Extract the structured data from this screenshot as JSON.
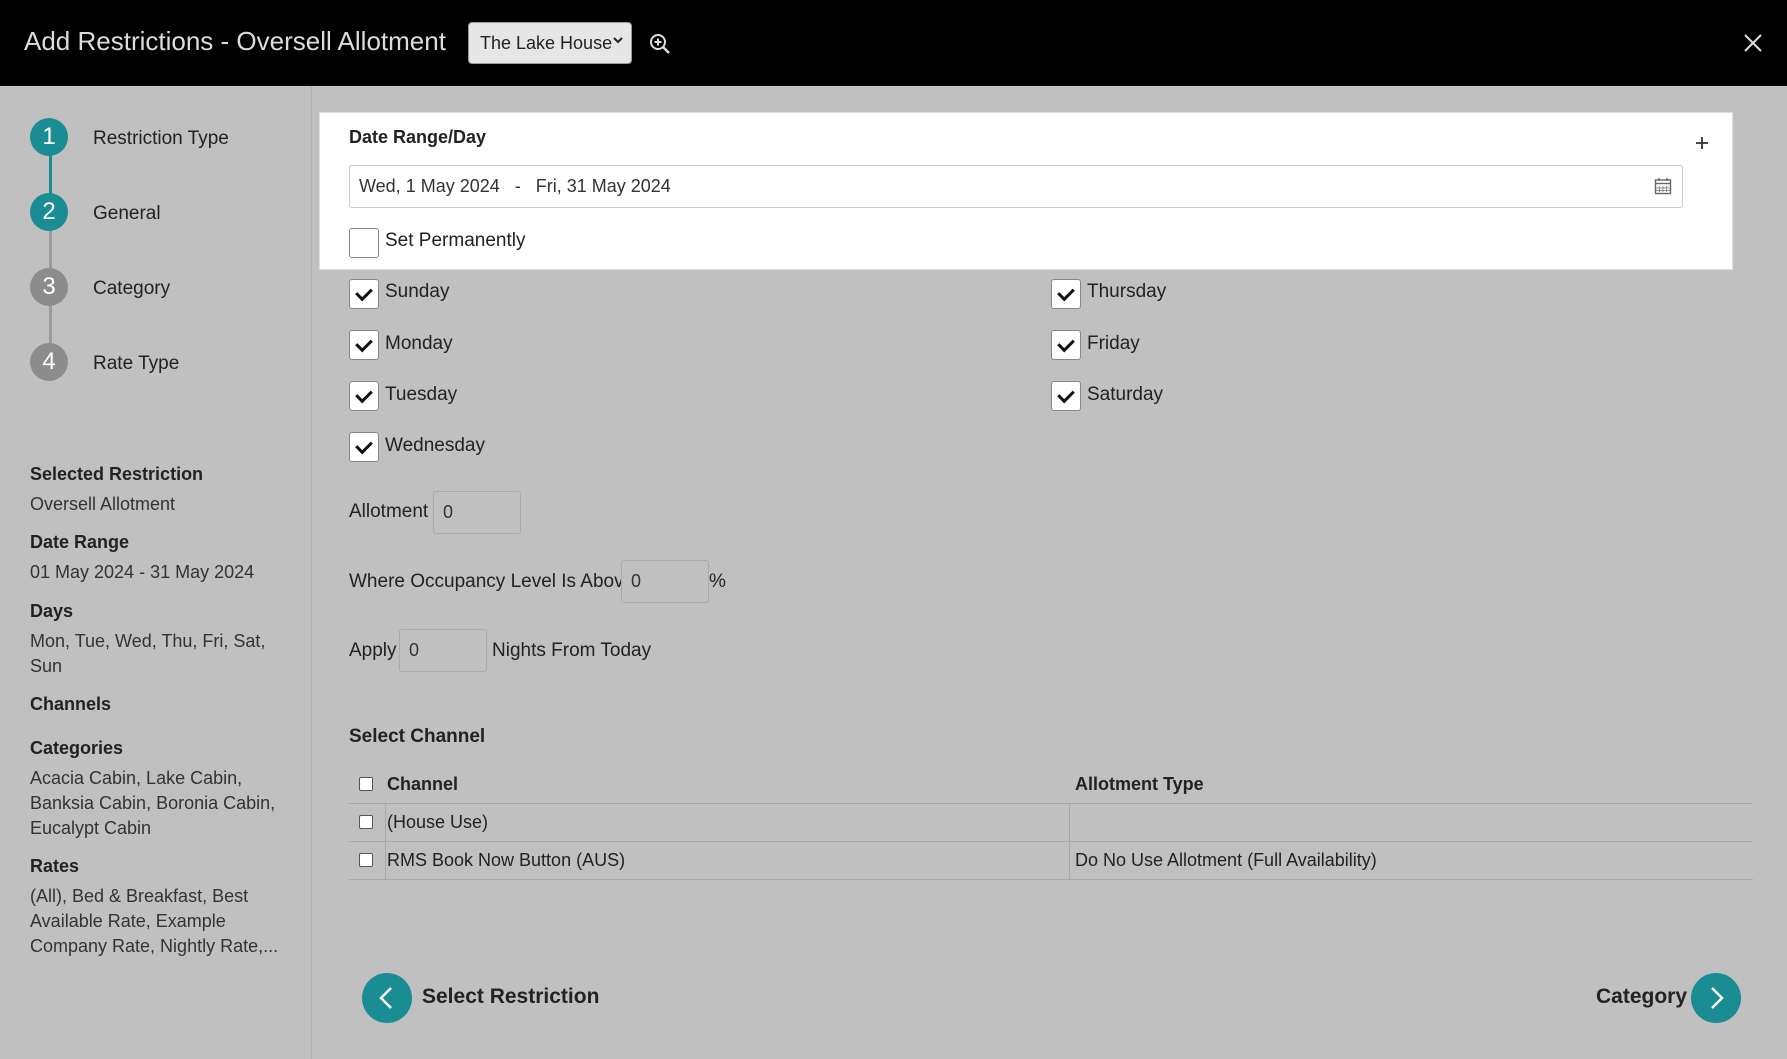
{
  "header": {
    "title": "Add Restrictions - Oversell Allotment",
    "property_select": "The Lake House"
  },
  "steps": [
    {
      "number": "1",
      "label": "Restriction Type"
    },
    {
      "number": "2",
      "label": "General"
    },
    {
      "number": "3",
      "label": "Category"
    },
    {
      "number": "4",
      "label": "Rate Type"
    }
  ],
  "summary": {
    "selected_restriction_label": "Selected Restriction",
    "selected_restriction_value": "Oversell Allotment",
    "date_range_label": "Date Range",
    "date_range_value": "01 May 2024 - 31 May 2024",
    "days_label": "Days",
    "days_value": "Mon, Tue, Wed, Thu, Fri, Sat, Sun",
    "channels_label": "Channels",
    "categories_label": "Categories",
    "categories_value": "Acacia Cabin, Lake Cabin, Banksia Cabin, Boronia Cabin, Eucalypt Cabin",
    "rates_label": "Rates",
    "rates_value": "(All), Bed & Breakfast, Best Available Rate, Example Company Rate, Nightly Rate,..."
  },
  "date_card": {
    "title": "Date Range/Day",
    "date_value": "Wed, 1 May 2024   -   Fri, 31 May 2024",
    "set_permanently": "Set Permanently"
  },
  "days": {
    "sunday": "Sunday",
    "monday": "Monday",
    "tuesday": "Tuesday",
    "wednesday": "Wednesday",
    "thursday": "Thursday",
    "friday": "Friday",
    "saturday": "Saturday"
  },
  "fields": {
    "allotment_label": "Allotment",
    "allotment_value": "0",
    "occupancy_label": "Where Occupancy Level Is Above",
    "occupancy_value": "0",
    "occupancy_unit": "%",
    "apply_label": "Apply",
    "apply_value": "0",
    "apply_suffix": "Nights From Today"
  },
  "channel_table": {
    "title": "Select Channel",
    "col_channel": "Channel",
    "col_allotment": "Allotment Type",
    "rows": [
      {
        "channel": "(House Use)",
        "allotment": ""
      },
      {
        "channel": "RMS Book Now Button (AUS)",
        "allotment": "Do No Use Allotment (Full Availability)"
      }
    ]
  },
  "nav": {
    "back_label": "Select Restriction",
    "next_label": "Category"
  },
  "colors": {
    "accent": "#1a8c94",
    "topbar": "#000000",
    "background": "#c0c0c0"
  }
}
